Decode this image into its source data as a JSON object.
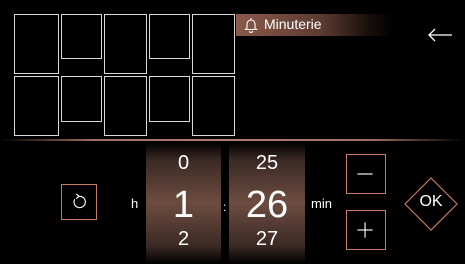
{
  "header": {
    "title": "Minuterie",
    "bell_icon": "bell-icon",
    "back_icon": "arrow-left-icon"
  },
  "timer": {
    "hours": {
      "prev": "0",
      "current": "1",
      "next": "2",
      "unit": "h"
    },
    "separator": ":",
    "minutes": {
      "prev": "25",
      "current": "26",
      "next": "27",
      "unit": "min"
    }
  },
  "buttons": {
    "reset_icon": "reset-icon",
    "minus_label": "−",
    "plus_label": "+",
    "ok_label": "OK"
  },
  "colors": {
    "accent": "#c77a5f",
    "header_bg": "#8a5a4a",
    "background": "#000000"
  }
}
